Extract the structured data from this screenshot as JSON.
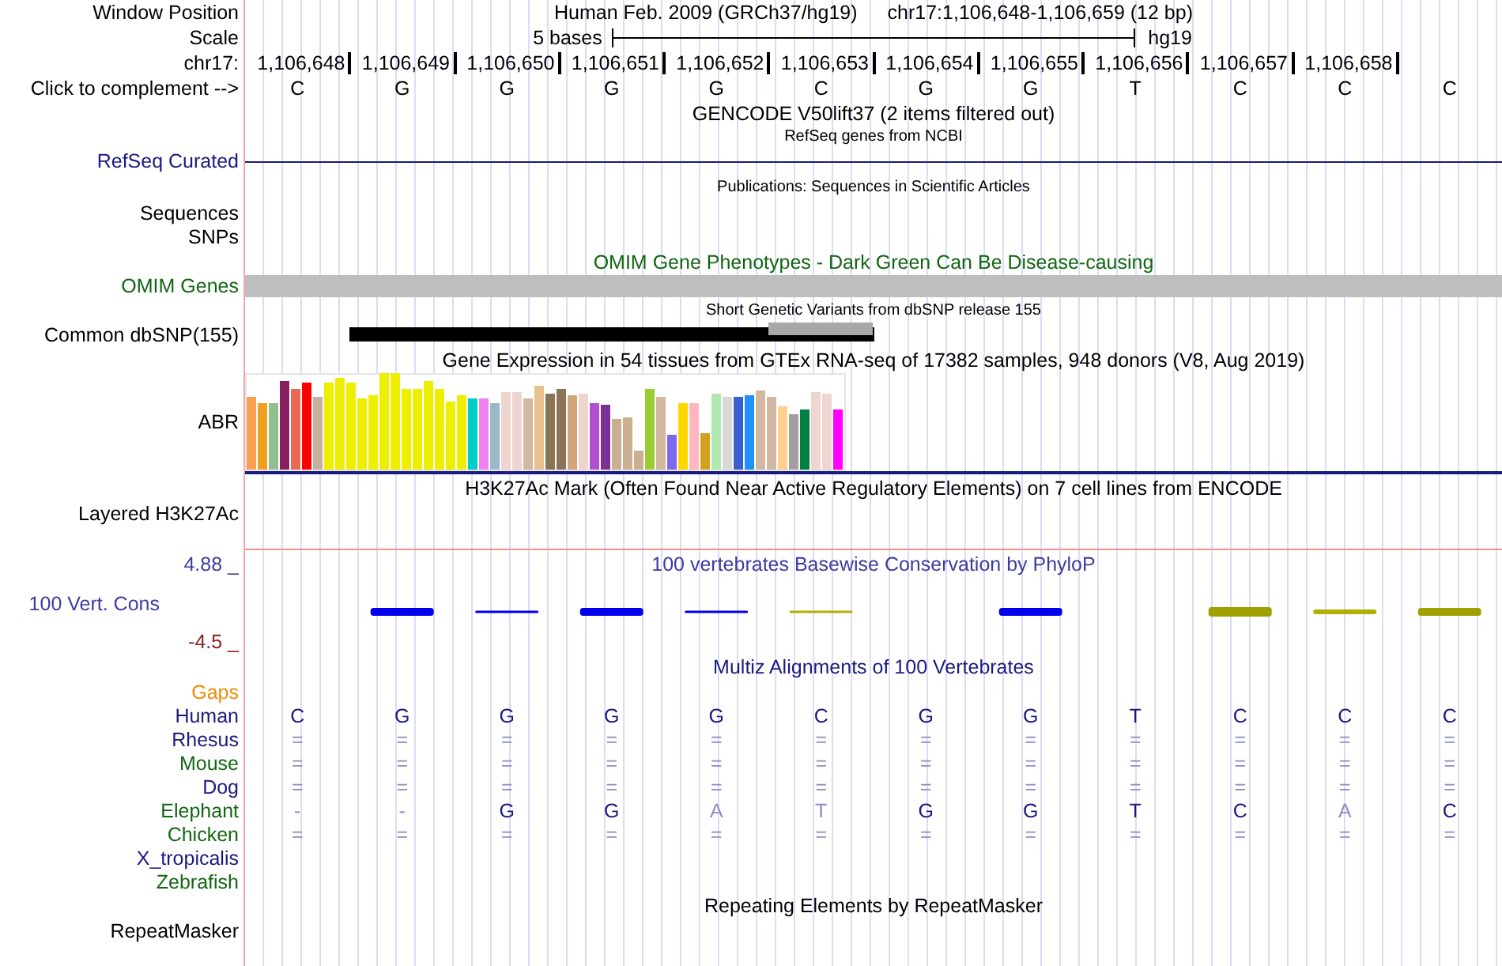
{
  "header": {
    "label": "Window Position",
    "assembly": "Human Feb. 2009 (GRCh37/hg19)",
    "position": "chr17:1,106,648-1,106,659 (12 bp)"
  },
  "scale": {
    "label": "Scale",
    "length": "5 bases",
    "assembly": "hg19"
  },
  "ruler": {
    "label": "chr17:",
    "positions": [
      "1,106,648",
      "1,106,649",
      "1,106,650",
      "1,106,651",
      "1,106,652",
      "1,106,653",
      "1,106,654",
      "1,106,655",
      "1,106,656",
      "1,106,657",
      "1,106,658"
    ]
  },
  "complement": {
    "label": "Click to complement -->",
    "bases": [
      "C",
      "G",
      "G",
      "G",
      "G",
      "C",
      "G",
      "G",
      "T",
      "C",
      "C",
      "C"
    ]
  },
  "gencode": {
    "title": "GENCODE V50lift37 (2 items filtered out)"
  },
  "refseq": {
    "subtitle": "RefSeq genes from NCBI",
    "label": "RefSeq Curated"
  },
  "publications": {
    "title": "Publications: Sequences in Scientific Articles",
    "labels": [
      "Sequences",
      "SNPs"
    ]
  },
  "omim": {
    "title": "OMIM Gene Phenotypes - Dark Green Can Be Disease-causing",
    "label": "OMIM Genes"
  },
  "dbsnp": {
    "title": "Short Genetic Variants from dbSNP release 155",
    "label": "Common dbSNP(155)"
  },
  "gtex": {
    "title": "Gene Expression in 54 tissues from GTEx RNA-seq of 17382 samples, 948 donors (V8, Aug 2019)",
    "label": "ABR"
  },
  "h3k27ac": {
    "title": "H3K27Ac Mark (Often Found Near Active Regulatory Elements) on 7 cell lines from ENCODE",
    "label": "Layered H3K27Ac"
  },
  "conservation": {
    "max": "4.88 _",
    "title": "100 vertebrates Basewise Conservation by PhyloP",
    "label": "100 Vert. Cons",
    "min": "-4.5 _"
  },
  "multiz": {
    "title": "Multiz Alignments of 100 Vertebrates",
    "gaps_label": "Gaps",
    "species": [
      {
        "name": "Human",
        "color": "#1a1a80",
        "bases": [
          "C",
          "G",
          "G",
          "G",
          "G",
          "C",
          "G",
          "G",
          "T",
          "C",
          "C",
          "C"
        ],
        "faded": [
          false,
          false,
          false,
          false,
          false,
          false,
          false,
          false,
          false,
          false,
          false,
          false
        ]
      },
      {
        "name": "Rhesus",
        "color": "#1a1a80",
        "bases": [
          "=",
          "=",
          "=",
          "=",
          "=",
          "=",
          "=",
          "=",
          "=",
          "=",
          "=",
          "="
        ],
        "faded": [
          true,
          true,
          true,
          true,
          true,
          true,
          true,
          true,
          true,
          true,
          true,
          true
        ]
      },
      {
        "name": "Mouse",
        "color": "#116611",
        "bases": [
          "=",
          "=",
          "=",
          "=",
          "=",
          "=",
          "=",
          "=",
          "=",
          "=",
          "=",
          "="
        ],
        "faded": [
          true,
          true,
          true,
          true,
          true,
          true,
          true,
          true,
          true,
          true,
          true,
          true
        ]
      },
      {
        "name": "Dog",
        "color": "#1a1a80",
        "bases": [
          "=",
          "=",
          "=",
          "=",
          "=",
          "=",
          "=",
          "=",
          "=",
          "=",
          "=",
          "="
        ],
        "faded": [
          true,
          true,
          true,
          true,
          true,
          true,
          true,
          true,
          true,
          true,
          true,
          true
        ]
      },
      {
        "name": "Elephant",
        "color": "#116611",
        "bases": [
          "-",
          "-",
          "G",
          "G",
          "A",
          "T",
          "G",
          "G",
          "T",
          "C",
          "A",
          "C"
        ],
        "faded": [
          true,
          true,
          false,
          false,
          true,
          true,
          false,
          false,
          false,
          false,
          true,
          false
        ]
      },
      {
        "name": "Chicken",
        "color": "#116611",
        "bases": [
          "=",
          "=",
          "=",
          "=",
          "=",
          "=",
          "=",
          "=",
          "=",
          "=",
          "=",
          "="
        ],
        "faded": [
          true,
          true,
          true,
          true,
          true,
          true,
          true,
          true,
          true,
          true,
          true,
          true
        ]
      },
      {
        "name": "X_tropicalis",
        "color": "#1a1a80"
      },
      {
        "name": "Zebrafish",
        "color": "#116611"
      }
    ]
  },
  "repeatmasker": {
    "title": "Repeating Elements by RepeatMasker",
    "label": "RepeatMasker"
  }
}
